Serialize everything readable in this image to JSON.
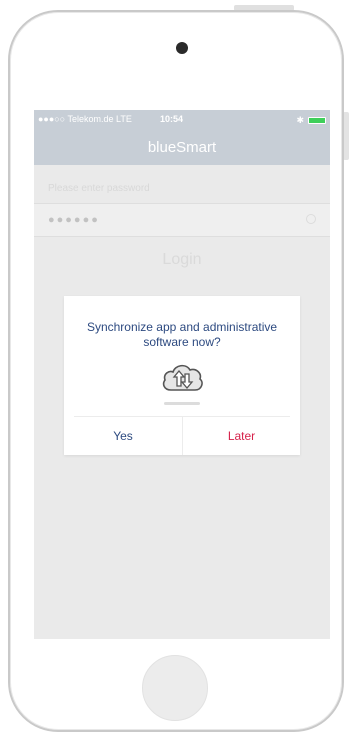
{
  "status_bar": {
    "carrier": "●●●○○ Telekom.de  LTE",
    "time": "10:54",
    "bluetooth_icon": "bluetooth-icon",
    "battery_icon": "battery-icon",
    "battery_color": "#3ecf5a"
  },
  "nav": {
    "title": "blueSmart"
  },
  "login_form": {
    "password_label": "Please enter password",
    "password_value": "●●●●●●",
    "reveal_icon": "eye-icon",
    "login_label": "Login"
  },
  "dialog": {
    "message": "Synchronize app and administrative software now?",
    "icon": "cloud-sync-icon",
    "yes_label": "Yes",
    "later_label": "Later",
    "yes_color": "#2d4a80",
    "later_color": "#d6224b"
  },
  "device": {
    "camera_icon": "camera-icon",
    "home_button_icon": "home-button-icon"
  }
}
